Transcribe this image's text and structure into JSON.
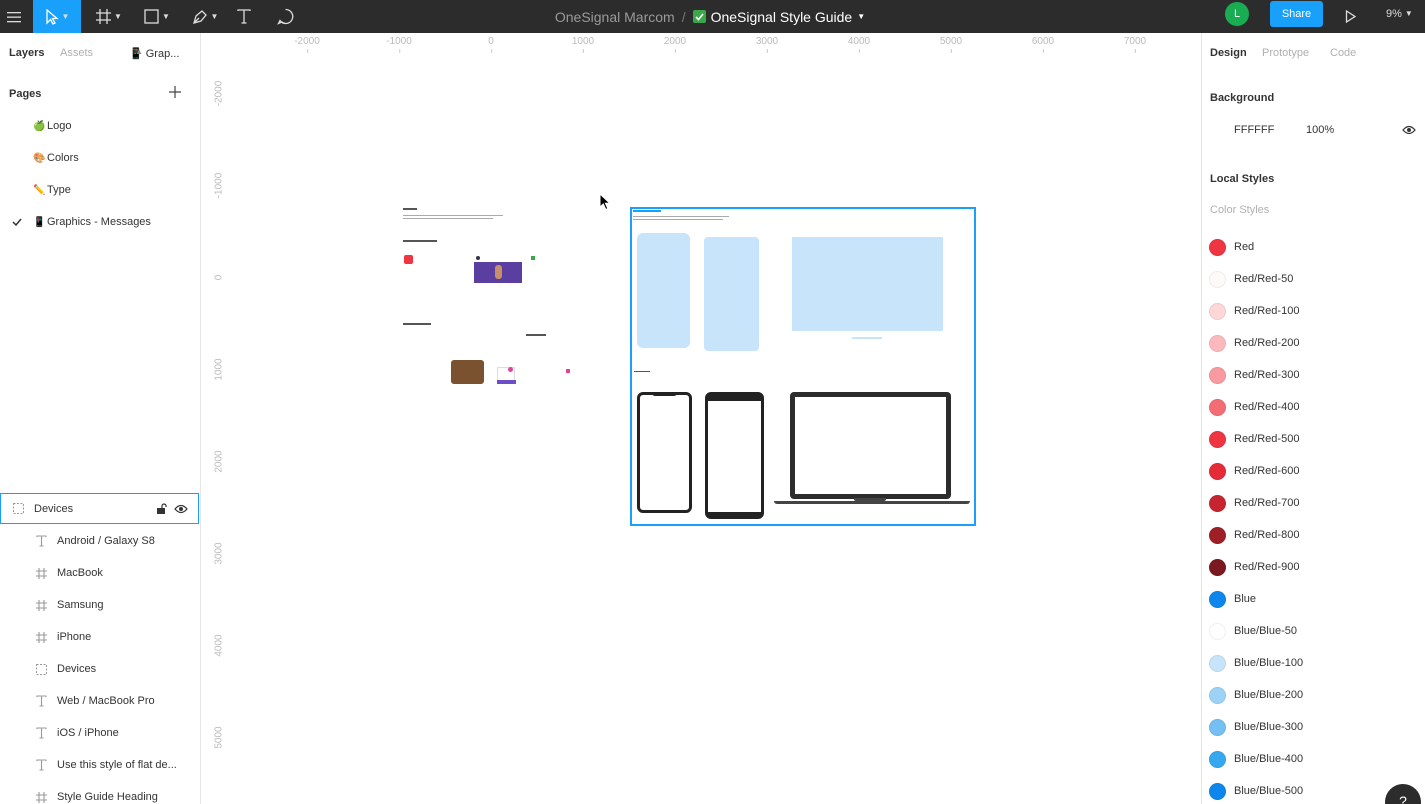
{
  "toolbar": {
    "project": "OneSignal Marcom",
    "separator": "/",
    "file_name": "OneSignal Style Guide",
    "avatar_initial": "L",
    "share_label": "Share",
    "zoom_label": "9%"
  },
  "left_panel": {
    "tab_layers": "Layers",
    "tab_assets": "Assets",
    "page_selector": "📱 Grap...",
    "pages_heading": "Pages",
    "pages": [
      {
        "emoji": "🍏",
        "label": "Logo"
      },
      {
        "emoji": "🎨",
        "label": "Colors"
      },
      {
        "emoji": "✏️",
        "label": "Type"
      },
      {
        "emoji": "📱",
        "label": "Graphics - Messages"
      }
    ],
    "selected_layer": "Devices",
    "layers": [
      {
        "icon": "text-icon",
        "label": "Android / Galaxy S8"
      },
      {
        "icon": "frame-icon",
        "label": "MacBook"
      },
      {
        "icon": "frame-icon",
        "label": "Samsung"
      },
      {
        "icon": "frame-icon",
        "label": "iPhone"
      },
      {
        "icon": "group-icon",
        "label": "Devices"
      },
      {
        "icon": "text-icon",
        "label": "Web / MacBook Pro"
      },
      {
        "icon": "text-icon",
        "label": "iOS / iPhone"
      },
      {
        "icon": "text-icon",
        "label": "Use this style of flat de..."
      },
      {
        "icon": "frame-icon",
        "label": "Style Guide Heading"
      }
    ]
  },
  "rulers": {
    "top": [
      "-2000",
      "-1000",
      "0",
      "1000",
      "2000",
      "3000",
      "4000",
      "5000",
      "6000",
      "7000"
    ],
    "left": [
      "-2000",
      "-1000",
      "0",
      "1000",
      "2000",
      "3000",
      "4000",
      "5000"
    ]
  },
  "right_panel": {
    "tab_design": "Design",
    "tab_prototype": "Prototype",
    "tab_code": "Code",
    "background_heading": "Background",
    "background_hex": "FFFFFF",
    "background_opacity": "100%",
    "local_styles_heading": "Local Styles",
    "color_styles_heading": "Color Styles",
    "color_styles": [
      {
        "name": "Red",
        "color": "#ef3541"
      },
      {
        "name": "Red/Red-50",
        "color": "#fffafa"
      },
      {
        "name": "Red/Red-100",
        "color": "#fdd6d8"
      },
      {
        "name": "Red/Red-200",
        "color": "#fbb9bd"
      },
      {
        "name": "Red/Red-300",
        "color": "#f89a9f"
      },
      {
        "name": "Red/Red-400",
        "color": "#f46d75"
      },
      {
        "name": "Red/Red-500",
        "color": "#ef3541"
      },
      {
        "name": "Red/Red-600",
        "color": "#e42b37"
      },
      {
        "name": "Red/Red-700",
        "color": "#c6252f"
      },
      {
        "name": "Red/Red-800",
        "color": "#9f1f27"
      },
      {
        "name": "Red/Red-900",
        "color": "#7a1920"
      },
      {
        "name": "Blue",
        "color": "#0d87eb"
      },
      {
        "name": "Blue/Blue-50",
        "color": "#ffffff"
      },
      {
        "name": "Blue/Blue-100",
        "color": "#c7e4fa"
      },
      {
        "name": "Blue/Blue-200",
        "color": "#9dd2f7"
      },
      {
        "name": "Blue/Blue-300",
        "color": "#74bff3"
      },
      {
        "name": "Blue/Blue-400",
        "color": "#35a8f0"
      },
      {
        "name": "Blue/Blue-500",
        "color": "#0d87eb"
      }
    ]
  },
  "help_label": "?"
}
